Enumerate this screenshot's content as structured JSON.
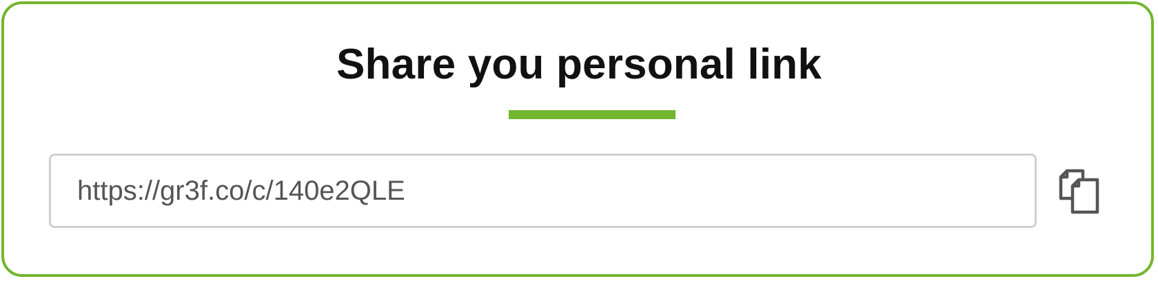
{
  "share": {
    "title": "Share you personal link",
    "link_value": "https://gr3f.co/c/140e2QLE",
    "copy_icon": "copy-icon"
  },
  "colors": {
    "accent": "#72b62e",
    "field_border": "#cfcfcf",
    "link_text": "#555555",
    "title_text": "#111111",
    "icon": "#555555"
  }
}
